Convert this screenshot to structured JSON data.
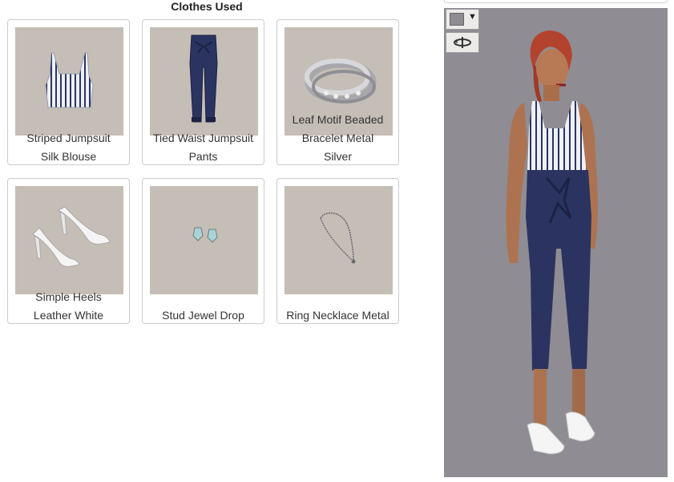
{
  "clothes": {
    "title": "Clothes Used",
    "items": [
      {
        "label_line1": "Striped Jumpsuit",
        "label_line2": "Silk Blouse",
        "icon": "striped-blouse-icon"
      },
      {
        "label_line1": "Tied Waist Jumpsuit",
        "label_line2": "Pants",
        "icon": "navy-pants-icon"
      },
      {
        "label_line1": "Leaf Motif Beaded",
        "label_line2": "Bracelet Metal",
        "label_line3": "Silver",
        "icon": "silver-bracelet-icon"
      },
      {
        "label_line1": "Simple Heels",
        "label_line2": "Leather White",
        "icon": "white-heels-icon"
      },
      {
        "label_line1": "Stud Jewel Drop",
        "icon": "stud-earrings-icon"
      },
      {
        "label_line1": "Ring Necklace Metal",
        "icon": "necklace-icon"
      }
    ]
  },
  "viewer": {
    "background_color": "#8f8c93",
    "controls": [
      {
        "icon": "background-color-swatch-icon"
      },
      {
        "icon": "rotate-icon"
      }
    ]
  },
  "colors": {
    "thumb_bg": "#c5beb6",
    "navy": "#2b3460",
    "card_border": "#cccccc"
  }
}
